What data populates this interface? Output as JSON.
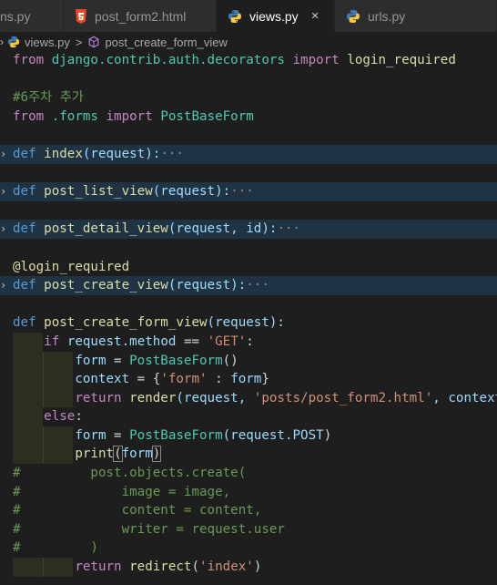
{
  "tabs": [
    {
      "label": "ns.py",
      "icon": "python-icon",
      "active": false
    },
    {
      "label": "post_form2.html",
      "icon": "html5-icon",
      "active": false
    },
    {
      "label": "views.py",
      "icon": "python-icon",
      "active": true,
      "close": "×"
    },
    {
      "label": "urls.py",
      "icon": "python-icon",
      "active": false
    }
  ],
  "breadcrumb": {
    "file": "views.py",
    "separator": ">",
    "symbol": "post_create_form_view"
  },
  "code": {
    "l1": {
      "from": "from",
      "module": "django.contrib.auth.decorators",
      "import": "import",
      "name": "login_required"
    },
    "l3": "#6주차 추가",
    "l4": {
      "from": "from",
      "module": ".forms",
      "import": "import",
      "name": "PostBaseForm"
    },
    "l6": {
      "def": "def",
      "name": "index",
      "args": "(request):",
      "ellipsis": "···"
    },
    "l8": {
      "def": "def",
      "name": "post_list_view",
      "args": "(request):",
      "ellipsis": "···"
    },
    "l10": {
      "def": "def",
      "name": "post_detail_view",
      "args": "(request, id):",
      "ellipsis": "···"
    },
    "l12": "@login_required",
    "l13": {
      "def": "def",
      "name": "post_create_view",
      "args": "(request):",
      "ellipsis": "···"
    },
    "l15": {
      "def": "def",
      "name": "post_create_form_view",
      "args": "(request):"
    },
    "l16": {
      "if": "if",
      "obj": "request",
      "attr": ".method",
      "op": " == ",
      "str": "'GET'",
      "colon": ":"
    },
    "l17": {
      "var": "form",
      "op": " = ",
      "cls": "PostBaseForm",
      "rest": "()"
    },
    "l18": {
      "var": "context",
      "op": " = {",
      "key": "'form'",
      "mid": " : ",
      "val": "form",
      "end": "}"
    },
    "l19": {
      "ret": "return",
      "fn": "render",
      "a": "(request, ",
      "str": "'posts/post_form2.html'",
      "b": ", context)"
    },
    "l20": {
      "else": "else",
      "colon": ":"
    },
    "l21": {
      "var": "form",
      "op": " = ",
      "cls": "PostBaseForm",
      "a": "(request.",
      "attr": "POST",
      "b": ")"
    },
    "l22": {
      "fn": "print",
      "open": "(",
      "arg": "form",
      "close": ")"
    },
    "l23": {
      "hash": "#",
      "text": "post.objects.create("
    },
    "l24": {
      "hash": "#",
      "text": "image = image,"
    },
    "l25": {
      "hash": "#",
      "text": "content = content,"
    },
    "l26": {
      "hash": "#",
      "text": "writer = request.user"
    },
    "l27": {
      "hash": "#",
      "text": ")"
    },
    "l28": {
      "ret": "return",
      "fn": "redirect",
      "a": "(",
      "str": "'index'",
      "b": ")"
    }
  },
  "colors": {
    "background": "#1e1e1e",
    "keyword_blue": "#569cd6",
    "keyword_purple": "#c586c0",
    "function": "#dcdcaa",
    "class": "#4ec9b0",
    "variable": "#9cdcfe",
    "string": "#ce9178",
    "comment": "#6a9955",
    "folded_highlight": "#1f3343"
  }
}
